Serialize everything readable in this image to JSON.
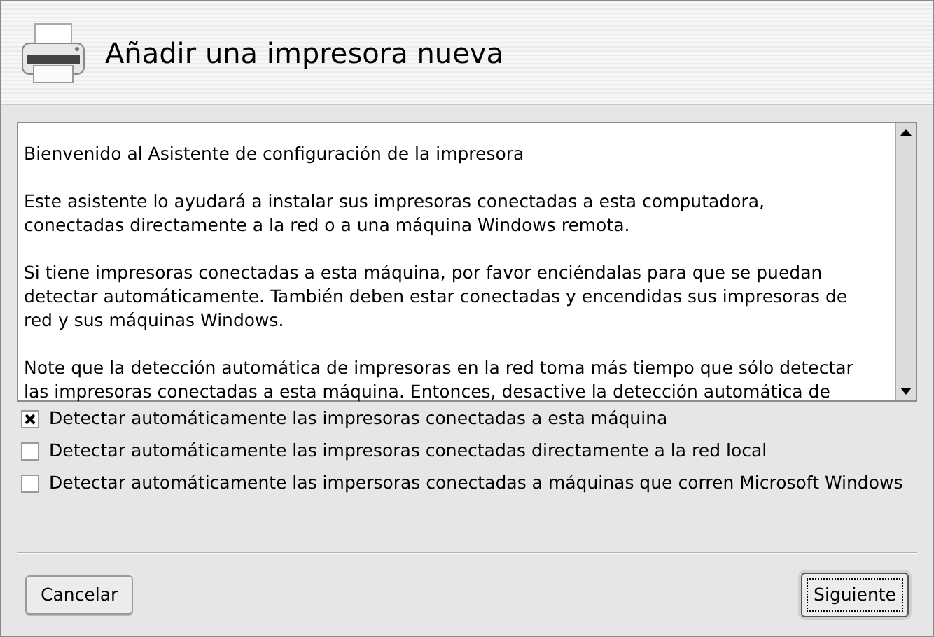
{
  "header": {
    "title": "Añadir una impresora nueva"
  },
  "intro": {
    "paragraphs": [
      [
        "Bienvenido al Asistente de configuración de la impresora"
      ],
      [
        "Este asistente lo ayudará a instalar sus impresoras conectadas a esta computadora,",
        "conectadas directamente a la red o a una máquina Windows remota."
      ],
      [
        "Si tiene impresoras conectadas a esta máquina, por favor enciéndalas para que se puedan",
        "detectar automáticamente. También deben estar conectadas y encendidas sus impresoras de",
        "red y sus máquinas Windows."
      ],
      [
        "Note que la detección automática de impresoras en la red toma más tiempo que sólo detectar",
        "las impresoras conectadas a esta máquina. Entonces, desactive la detección automática de"
      ]
    ]
  },
  "options": [
    {
      "label": "Detectar automáticamente las impresoras conectadas a esta máquina",
      "checked": true
    },
    {
      "label": "Detectar automáticamente las impresoras conectadas directamente a la red local",
      "checked": false
    },
    {
      "label": "Detectar automáticamente las impersoras conectadas a máquinas que corren Microsoft Windows",
      "checked": false
    }
  ],
  "buttons": [
    {
      "label": "Cancelar",
      "default": false
    },
    {
      "label": "Siguiente",
      "default": true
    }
  ]
}
